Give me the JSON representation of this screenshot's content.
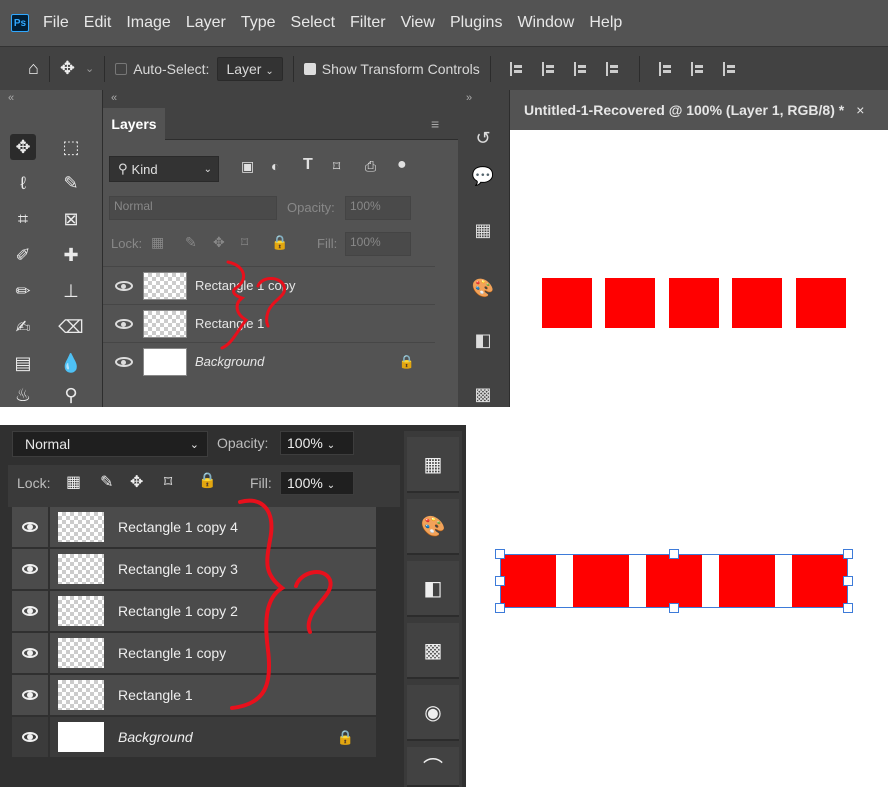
{
  "app": {
    "logo": "Ps"
  },
  "menubar": {
    "items": [
      "File",
      "Edit",
      "Image",
      "Layer",
      "Type",
      "Select",
      "Filter",
      "View",
      "Plugins",
      "Window",
      "Help"
    ]
  },
  "options_bar": {
    "auto_select_label": "Auto-Select:",
    "auto_select_checked": false,
    "layer_dropdown": "Layer",
    "show_transform_label": "Show Transform Controls",
    "show_transform_checked": true
  },
  "layers_panel_top": {
    "tab": "Layers",
    "filter_kind": "Kind",
    "blend_mode": "Normal",
    "opacity_label": "Opacity:",
    "opacity_value": "100%",
    "lock_label": "Lock:",
    "fill_label": "Fill:",
    "fill_value": "100%",
    "layers": [
      {
        "name": "Rectangle 1 copy",
        "thumb": "transparent"
      },
      {
        "name": "Rectangle 1",
        "thumb": "transparent"
      },
      {
        "name": "Background",
        "thumb": "white",
        "locked": true
      }
    ]
  },
  "document": {
    "tab_title": "Untitled-1-Recovered @ 100% (Layer 1, RGB/8) *",
    "close": "×",
    "shape_color": "#ff0000",
    "square_count": 5
  },
  "layers_panel_bottom": {
    "blend_mode": "Normal",
    "opacity_label": "Opacity:",
    "opacity_value": "100%",
    "lock_label": "Lock:",
    "fill_label": "Fill:",
    "fill_value": "100%",
    "layers": [
      {
        "name": "Rectangle 1 copy 4"
      },
      {
        "name": "Rectangle 1 copy 3"
      },
      {
        "name": "Rectangle 1 copy 2"
      },
      {
        "name": "Rectangle 1 copy"
      },
      {
        "name": "Rectangle 1"
      },
      {
        "name": "Background",
        "locked": true
      }
    ]
  },
  "annotation": {
    "color": "#e8101c",
    "marks": [
      "brace",
      "question-mark"
    ]
  },
  "colors": {
    "panel": "#535353",
    "panel_dark": "#303030",
    "accent_selection": "#3d7bd9",
    "red": "#ff0000"
  }
}
